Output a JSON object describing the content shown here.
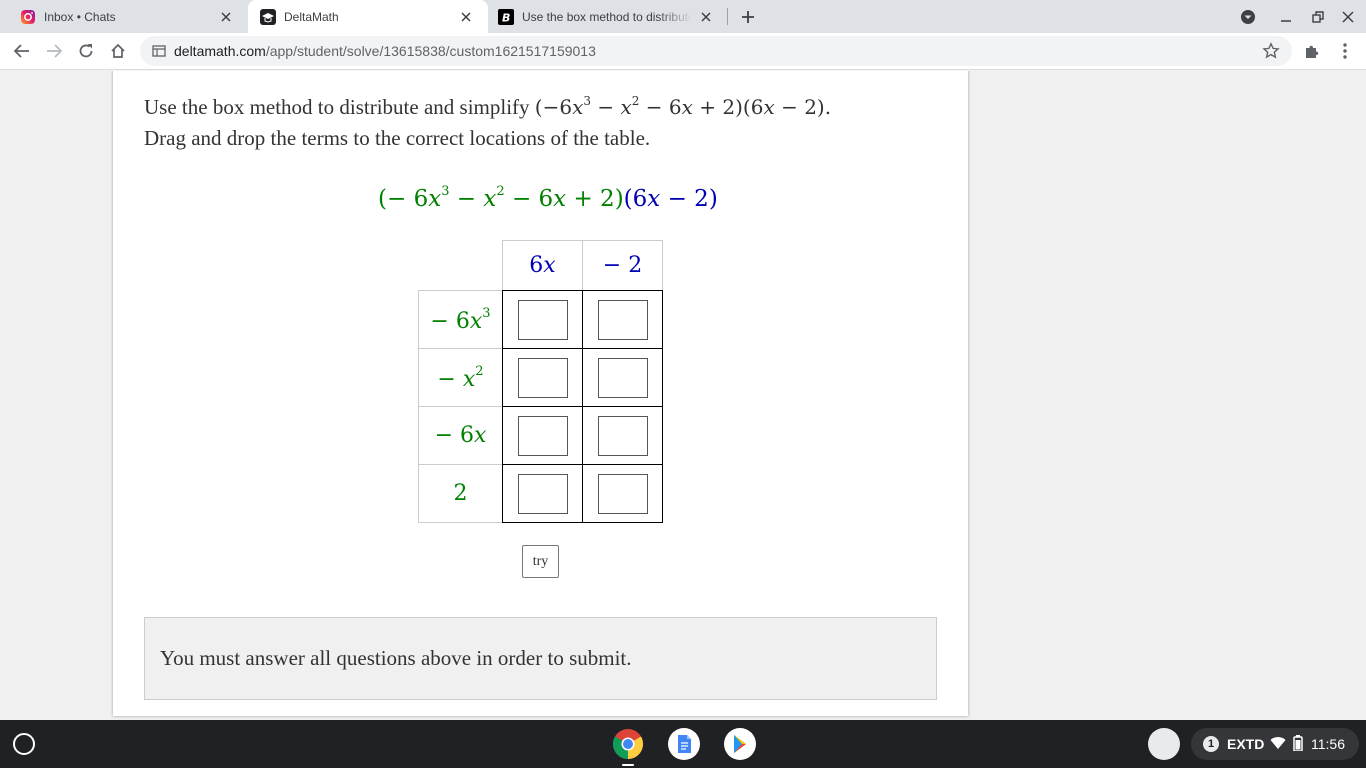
{
  "browser": {
    "tabs": [
      {
        "title": "Inbox • Chats",
        "active": false,
        "icon": "instagram-icon"
      },
      {
        "title": "DeltaMath",
        "active": true,
        "icon": "graduation-cap-icon"
      },
      {
        "title": "Use the box method to distribute",
        "active": false,
        "icon": "brainly-icon"
      }
    ],
    "url_host": "deltamath.com",
    "url_path": "/app/student/solve/13615838/custom1621517159013"
  },
  "problem": {
    "prompt_line1": "Use the box method to distribute and simplify",
    "prompt_line2": "Drag and drop the terms to the correct locations of the table.",
    "column_headers": [
      "6x",
      "− 2"
    ],
    "row_headers": [
      "− 6x³",
      "− x²",
      "− 6x",
      "2"
    ],
    "try_label": "try",
    "notice": "You must answer all questions above in order to submit."
  },
  "colors": {
    "green_term": "#008000",
    "blue_term": "#0000b3"
  },
  "shelf": {
    "tray_notification_count": "1",
    "tray_label": "EXTD",
    "clock": "11:56",
    "apps": [
      "chrome-icon",
      "docs-icon",
      "play-store-icon"
    ]
  }
}
